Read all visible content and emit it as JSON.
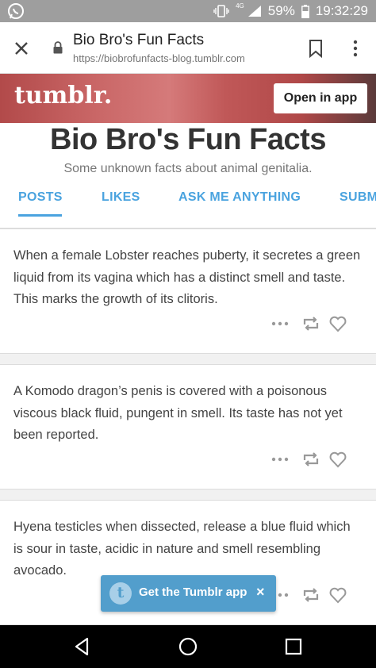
{
  "status_bar": {
    "network": "4G",
    "battery": "59%",
    "time": "19:32:29"
  },
  "browser": {
    "page_title": "Bio Bro's Fun Facts",
    "url": "https://biobrofunfacts-blog.tumblr.com"
  },
  "banner": {
    "logo": "tumblr.",
    "open_app_label": "Open in app"
  },
  "blog": {
    "title": "Bio Bro's Fun Facts",
    "description": "Some unknown facts about animal genitalia.",
    "tabs": [
      {
        "label": "POSTS",
        "active": true
      },
      {
        "label": "LIKES"
      },
      {
        "label": "ASK ME ANYTHING"
      },
      {
        "label": "SUBM"
      }
    ]
  },
  "posts": [
    {
      "text": "When a female Lobster reaches puberty, it secretes a green liquid from its vagina which has a distinct smell and taste. This marks the growth of its clitoris."
    },
    {
      "text": "A Komodo dragon’s penis is covered with a poisonous viscous black fluid, pungent in smell. Its taste has not yet been reported."
    },
    {
      "text": "Hyena testicles when dissected, release a blue fluid which is sour in taste, acidic in nature and smell resembling avocado."
    }
  ],
  "toast": {
    "logo": "t",
    "label": "Get the Tumblr app",
    "close": "×"
  },
  "colors": {
    "accent": "#4aa3df",
    "toast_bg": "#529ecc",
    "status_bar": "#9e9e9e"
  }
}
